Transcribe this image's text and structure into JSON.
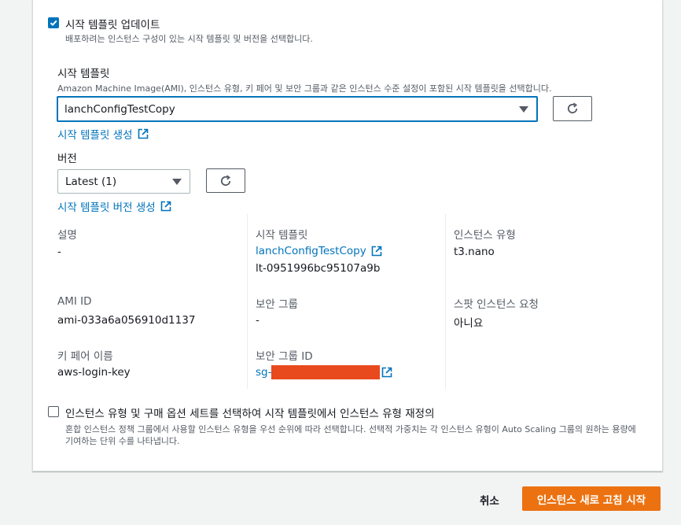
{
  "update_template": {
    "checked": true,
    "label": "시작 템플릿 업데이트",
    "description": "배포하려는 인스턴스 구성이 있는 시작 템플릿 및 버전을 선택합니다."
  },
  "launch_template": {
    "label": "시작 템플릿",
    "description": "Amazon Machine Image(AMI), 인스턴스 유형, 키 페어 및 보안 그룹과 같은 인스턴스 수준 설정이 포함된 시작 템플릿을 선택합니다.",
    "selected": "lanchConfigTestCopy",
    "create_link": "시작 템플릿 생성"
  },
  "version": {
    "label": "버전",
    "selected": "Latest (1)",
    "create_link": "시작 템플릿 버전 생성"
  },
  "details": {
    "description_label": "설명",
    "description_value": "-",
    "template_label": "시작 템플릿",
    "template_link": "lanchConfigTestCopy",
    "template_id": "lt-0951996bc95107a9b",
    "instance_type_label": "인스턴스 유형",
    "instance_type_value": "t3.nano",
    "ami_label": "AMI ID",
    "ami_value": "ami-033a6a056910d1137",
    "sg_label": "보안 그룹",
    "sg_value": "-",
    "spot_label": "스팟 인스턴스 요청",
    "spot_value": "아니요",
    "keypair_label": "키 페어 이름",
    "keypair_value": "aws-login-key",
    "sg_id_label": "보안 그룹 ID",
    "sg_id_prefix": "sg-"
  },
  "override": {
    "checked": false,
    "label": "인스턴스 유형 및 구매 옵션 세트를 선택하여 시작 템플릿에서 인스턴스 유형 재정의",
    "description_line1": "혼합 인스턴스 정책 그룹에서 사용할 인스턴스 유형을 우선 순위에 따라 선택합니다. 선택적 가중치는 각 인스턴스 유형이 Auto Scaling 그룹의 원하는 용량에",
    "description_line2": "기여하는 단위 수를 나타냅니다."
  },
  "footer": {
    "cancel": "취소",
    "submit": "인스턴스 새로 고침 시작"
  },
  "colors": {
    "accent": "#0073bb",
    "primary_button": "#ec7211",
    "redaction": "#e8491d"
  }
}
